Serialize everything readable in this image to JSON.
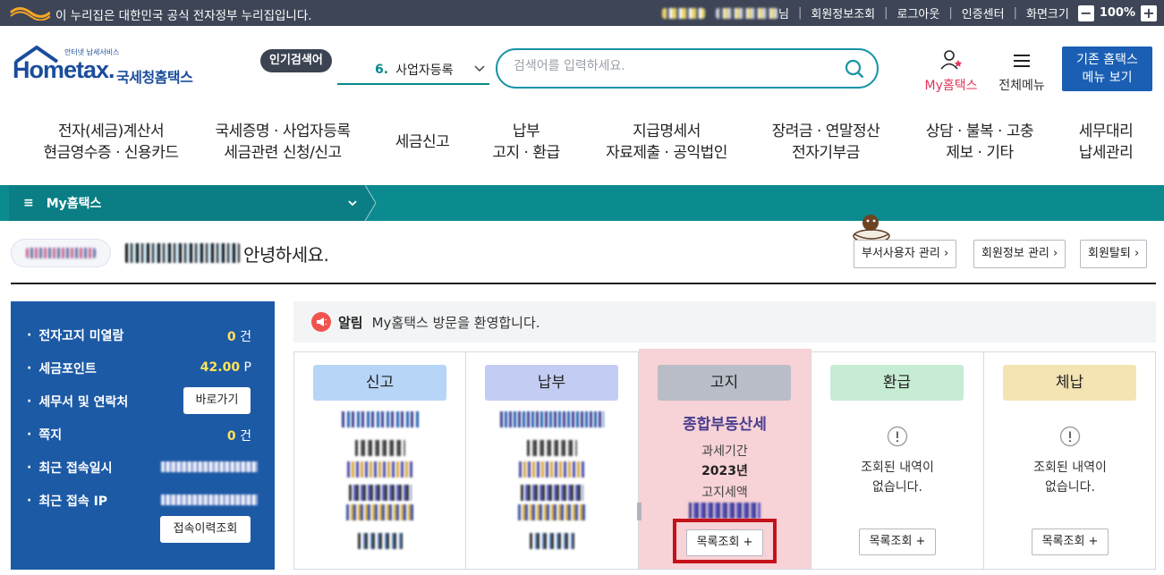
{
  "gov_banner": {
    "text": "이 누리집은 대한민국 공식 전자정부 누리집입니다.",
    "user_suffix": "님",
    "links": [
      "회원정보조회",
      "로그아웃",
      "인증센터",
      "화면크기"
    ],
    "zoom": "100%",
    "zoom_minus": "−",
    "zoom_plus": "+"
  },
  "header": {
    "logo_small": "안터넷 납세서비스",
    "logo_main": "Hometax.",
    "logo_kr": "국세청홈택스",
    "popular_badge": "인기검색어",
    "popular_num": "6.",
    "popular_term": "사업자등록",
    "search_placeholder": "검색어를 입력하세요.",
    "my_home": "My홈택스",
    "all_menu": "전체메뉴",
    "old_home_line1": "기존 홈택스",
    "old_home_line2": "메뉴 보기"
  },
  "gnb": [
    {
      "line1": "전자(세금)계산서",
      "line2": "현금영수증 · 신용카드"
    },
    {
      "line1": "국세증명 · 사업자등록",
      "line2": "세금관련 신청/신고"
    },
    {
      "line1": "세금신고",
      "line2": ""
    },
    {
      "line1": "납부",
      "line2": "고지 · 환급"
    },
    {
      "line1": "지급명세서",
      "line2": "자료제출 · 공익법인"
    },
    {
      "line1": "장려금 · 연말정산",
      "line2": "전자기부금"
    },
    {
      "line1": "상담 · 불복 · 고충",
      "line2": "제보 · 기타"
    },
    {
      "line1": "세무대리",
      "line2": "납세관리"
    }
  ],
  "breadcrumb": {
    "label": "My홈택스",
    "hamburger": "≡"
  },
  "greeting": {
    "text": "안녕하세요."
  },
  "top_buttons": [
    "부서사용자 관리 ›",
    "회원정보 관리 ›",
    "회원탈퇴 ›"
  ],
  "info": {
    "rows": [
      {
        "label": "전자고지 미열람",
        "value": "0",
        "unit": "건"
      },
      {
        "label": "세금포인트",
        "value": "42.00",
        "unit": "P"
      },
      {
        "label": "세무서 및 연락처",
        "button": "바로가기"
      },
      {
        "label": "쪽지",
        "value": "0",
        "unit": "건"
      },
      {
        "label": "최근 접속일시"
      },
      {
        "label": "최근 접속 IP"
      }
    ],
    "history_button": "접속이력조회"
  },
  "notice": {
    "label": "알림",
    "text": "My홈택스 방문을 환영합니다."
  },
  "cards": [
    {
      "head": "신고",
      "color": "#b7d5f7"
    },
    {
      "head": "납부",
      "color": "#c3cdf3"
    },
    {
      "head": "고지",
      "color": "#b9bdc7",
      "title": "종합부동산세",
      "period_label": "과세기간",
      "period_value": "2023년",
      "amount_label": "고지세액",
      "button": "목록조회 +"
    },
    {
      "head": "환급",
      "color": "#c7ecd4",
      "empty_line1": "조회된 내역이",
      "empty_line2": "없습니다.",
      "button": "목록조회 +"
    },
    {
      "head": "체납",
      "color": "#f4e3b3",
      "empty_line1": "조회된 내역이",
      "empty_line2": "없습니다.",
      "button": "목록조회 +"
    }
  ],
  "colors": {
    "teal": "#0b8a8f",
    "brand_blue": "#1c5aa6",
    "highlight": "#f7d2d6",
    "alert_red": "#c4121a"
  }
}
